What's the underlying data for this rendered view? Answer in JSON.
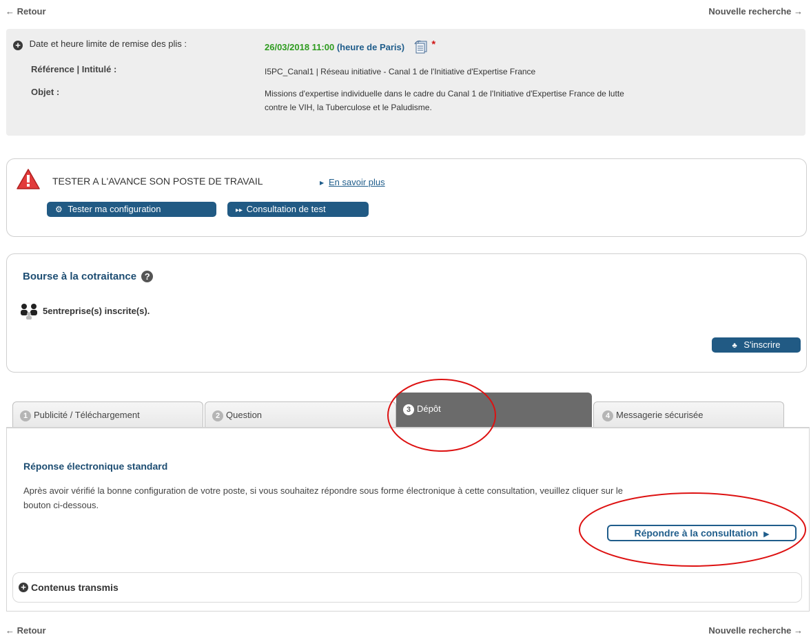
{
  "nav": {
    "back": "Retour",
    "new_search": "Nouvelle recherche",
    "back_arrow": "←",
    "forward_arrow": "→"
  },
  "info": {
    "deadline_label": "Date et heure limite de remise des plis :",
    "deadline_value": "26/03/2018 11:00",
    "deadline_tz": "(heure de Paris)",
    "reference_label": "Référence | Intitulé :",
    "reference_value": "I5PC_Canal1 | Réseau initiative - Canal 1 de l'Initiative d'Expertise France",
    "objet_label": "Objet :",
    "objet_value_line1": "Missions d'expertise individuelle dans le cadre du Canal 1 de l'Initiative d'Expertise France de lutte",
    "objet_value_line2": "contre le VIH, la Tuberculose et le Paludisme.",
    "star": "*"
  },
  "tester": {
    "title": "TESTER A L'AVANCE SON POSTE DE TRAVAIL",
    "learn_more": "En savoir plus",
    "btn_config": "Tester ma configuration",
    "btn_test": "Consultation de test"
  },
  "bourse": {
    "title": "Bourse à la cotraitance",
    "count_text": "5entreprise(s) inscrite(s).",
    "register_btn": "S'inscrire"
  },
  "tabs": [
    {
      "num": "1",
      "label": "Publicité / Téléchargement"
    },
    {
      "num": "2",
      "label": "Question"
    },
    {
      "num": "3",
      "label": "Dépôt"
    },
    {
      "num": "4",
      "label": "Messagerie sécurisée"
    }
  ],
  "depot": {
    "title": "Réponse électronique standard",
    "desc_line1": "Après avoir vérifié la bonne configuration de votre poste, si vous souhaitez répondre sous forme électronique à cette consultation, veuillez cliquer sur le",
    "desc_line2": "bouton ci-dessous.",
    "respond_btn": "Répondre à la consultation",
    "contenus": "Contenus transmis"
  },
  "colors": {
    "accent_blue": "#1f5d8b",
    "button_dark": "#215a84",
    "date_green": "#2e9b1f",
    "annotation_red": "#dd1111",
    "active_tab": "#6b6b6b"
  }
}
